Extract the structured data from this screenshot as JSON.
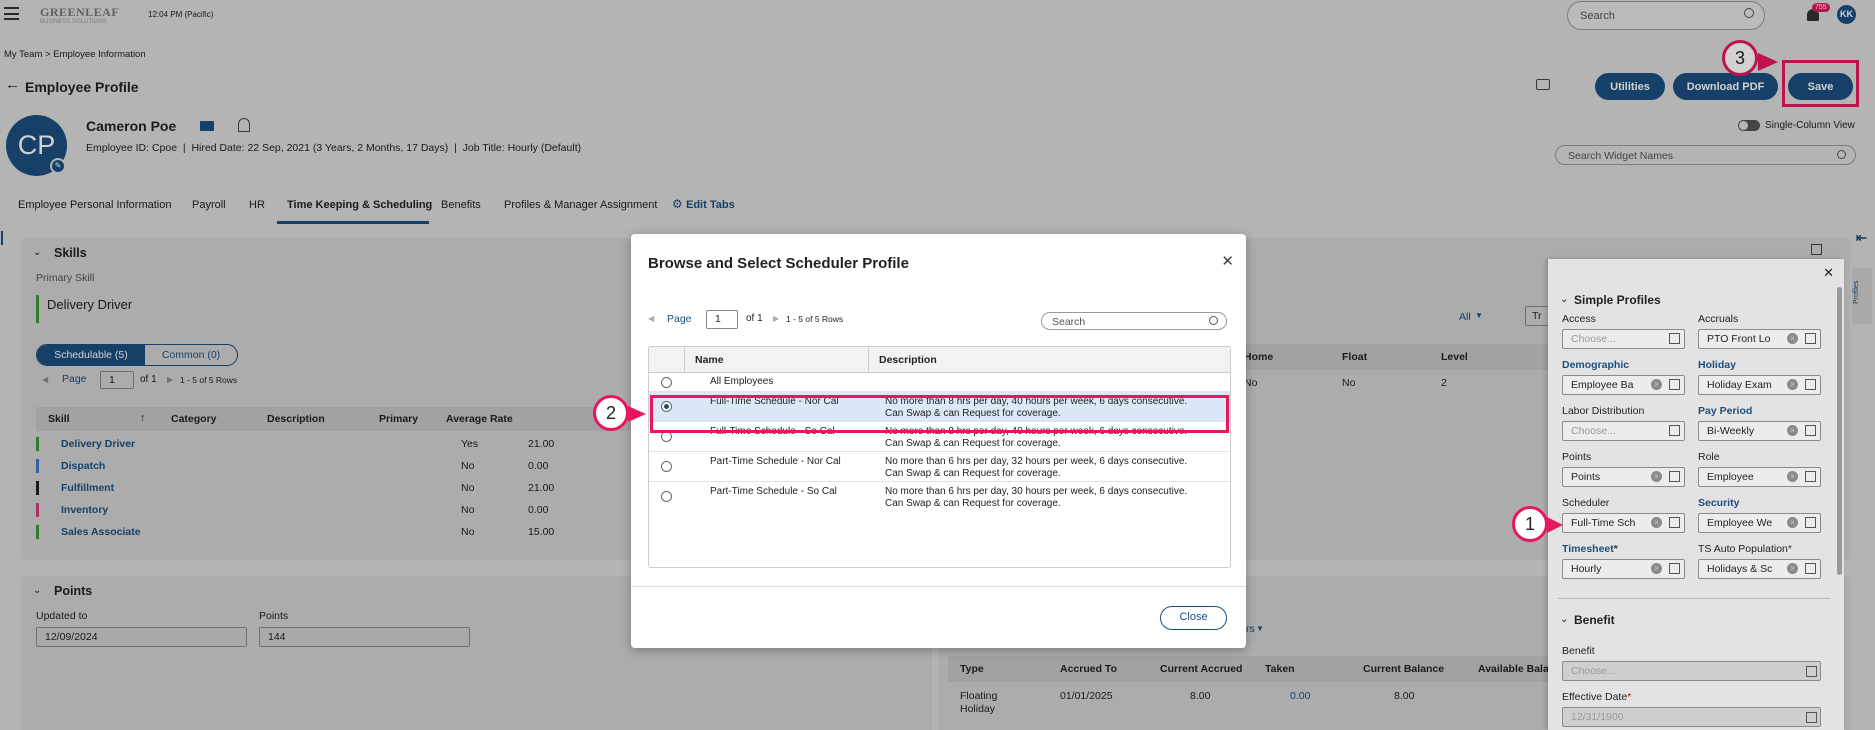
{
  "header": {
    "logo_main": "GREENLEAF",
    "logo_sub": "BUSINESS SOLUTIONS",
    "time": "12:04 PM (Pacific)",
    "search_placeholder": "Search",
    "notif_count": "755",
    "user_initials": "KK"
  },
  "breadcrumb": {
    "parent": "My Team",
    "sep": ">",
    "current": "Employee Information"
  },
  "page": {
    "title": "Employee Profile",
    "btn_utilities": "Utilities",
    "btn_download": "Download PDF",
    "btn_save": "Save",
    "single_column": "Single-Column View",
    "widget_search_placeholder": "Search Widget Names"
  },
  "employee": {
    "initials": "CP",
    "name": "Cameron Poe",
    "details": "Employee ID: Cpoe  |  Hired Date: 22 Sep, 2021 (3 Years, 2 Months, 17 Days)  |  Job Title: Hourly (Default)"
  },
  "tabs": [
    "Employee Personal Information",
    "Payroll",
    "HR",
    "Time Keeping & Scheduling",
    "Benefits",
    "Profiles & Manager Assignment",
    "Edit Tabs"
  ],
  "skills": {
    "title": "Skills",
    "primary_label": "Primary Skill",
    "primary_value": "Delivery Driver",
    "tab_schedulable": "Schedulable (5)",
    "tab_common": "Common (0)",
    "page_label": "Page",
    "page_value": "1",
    "page_of": "of 1",
    "page_rows": "1 - 5 of 5 Rows",
    "columns": [
      "Skill",
      "Category",
      "Description",
      "Primary",
      "Average Rate"
    ],
    "rows": [
      {
        "skill": "Delivery Driver",
        "primary": "Yes",
        "rate": "21.00",
        "color": "#3a9a3a"
      },
      {
        "skill": "Dispatch",
        "primary": "No",
        "rate": "0.00",
        "color": "#3a78c8"
      },
      {
        "skill": "Fulfillment",
        "primary": "No",
        "rate": "21.00",
        "color": "#222222"
      },
      {
        "skill": "Inventory",
        "primary": "No",
        "rate": "0.00",
        "color": "#d43a7a"
      },
      {
        "skill": "Sales Associate",
        "primary": "No",
        "rate": "15.00",
        "color": "#3a9a3a"
      }
    ]
  },
  "points": {
    "title": "Points",
    "updated_label": "Updated to",
    "updated_value": "12/09/2024",
    "points_label": "Points",
    "points_value": "144"
  },
  "bg_right": {
    "filter_all": "All",
    "filter_tr": "Tr",
    "columns": [
      "Home",
      "Float",
      "Level"
    ],
    "row": [
      "No",
      "No",
      "2"
    ],
    "acc_columns": [
      "Type",
      "Accrued To",
      "Current Accrued",
      "Taken",
      "Current Balance",
      "Available Balanc"
    ],
    "acc_row": [
      "Floating Holiday",
      "01/01/2025",
      "8.00",
      "0.00",
      "8.00"
    ],
    "link_fragment": "rs"
  },
  "profiles": {
    "section_title": "Simple Profiles",
    "side_tab": "Profiles",
    "fields": [
      {
        "label": "Access",
        "value": "Choose..."
      },
      {
        "label": "Accruals",
        "value": "PTO Front Lo"
      },
      {
        "label": "Demographic",
        "value": "Employee Ba"
      },
      {
        "label": "Holiday",
        "value": "Holiday Exam"
      },
      {
        "label": "Labor Distribution",
        "value": "Choose..."
      },
      {
        "label": "Pay Period",
        "value": "Bi-Weekly"
      },
      {
        "label": "Points",
        "value": "Points"
      },
      {
        "label": "Role",
        "value": "Employee"
      },
      {
        "label": "Scheduler",
        "value": "Full-Time Sch"
      },
      {
        "label": "Security",
        "value": "Employee We"
      },
      {
        "label": "Timesheet",
        "value": "Hourly"
      },
      {
        "label": "TS Auto Population",
        "value": "Holidays & Sc"
      }
    ],
    "benefit_title": "Benefit",
    "benefit_label": "Benefit",
    "benefit_value": "Choose...",
    "eff_label": "Effective Date",
    "eff_value": "12/31/1900"
  },
  "modal": {
    "title": "Browse and Select Scheduler Profile",
    "page_label": "Page",
    "page_value": "1",
    "page_of": "of 1",
    "page_rows": "1 - 5 of 5 Rows",
    "search_placeholder": "Search",
    "columns": [
      "Name",
      "Description"
    ],
    "rows": [
      {
        "name": "All Employees",
        "desc1": "",
        "desc2": "",
        "selected": false
      },
      {
        "name": "Full-Time Schedule - Nor Cal",
        "desc1": "No more than 8 hrs per day, 40 hours per week, 6 days consecutive.",
        "desc2": "Can Swap & can Request for coverage.",
        "selected": true
      },
      {
        "name": "Full-Time Schedule - So Cal",
        "desc1": "No more than 8 hrs per day, 40 hours per week, 6 days consecutive.",
        "desc2": "Can Swap & can Request for coverage.",
        "selected": false
      },
      {
        "name": "Part-Time Schedule - Nor Cal",
        "desc1": "No more than 6 hrs per day, 32 hours per week, 6 days consecutive.",
        "desc2": "Can Swap & can Request for coverage.",
        "selected": false
      },
      {
        "name": "Part-Time Schedule - So Cal",
        "desc1": "No more than 6 hrs per day, 30 hours per week, 6 days consecutive.",
        "desc2": "Can Swap & can Request for coverage.",
        "selected": false
      }
    ],
    "close_label": "Close"
  },
  "callouts": [
    "1",
    "2",
    "3"
  ],
  "colors": {
    "brand": "#1c4f7e",
    "callout": "#e8175d",
    "selected_row": "#dbe8f7"
  }
}
